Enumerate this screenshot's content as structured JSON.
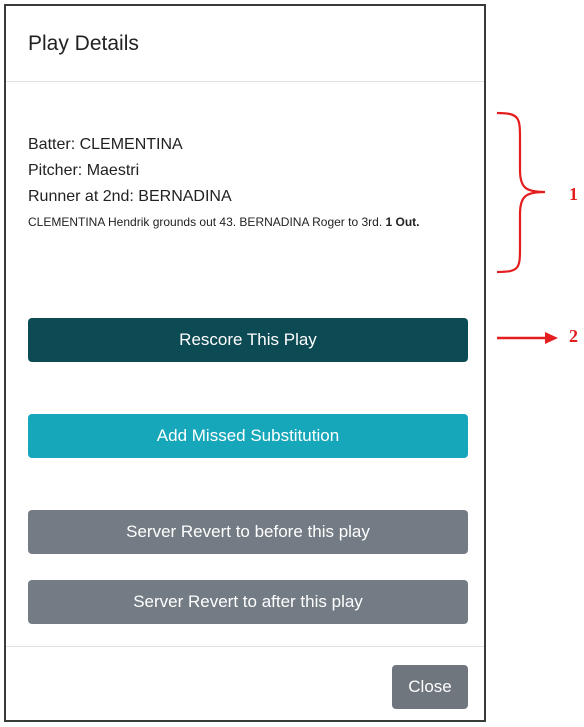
{
  "modal": {
    "title": "Play Details",
    "batter": "Batter: CLEMENTINA",
    "pitcher": "Pitcher: Maestri",
    "runner": "Runner at 2nd: BERNADINA",
    "description": "CLEMENTINA Hendrik grounds out 43. BERNADINA Roger to 3rd.",
    "outs": "1 Out."
  },
  "buttons": {
    "rescore": "Rescore This Play",
    "missed_substitution": "Add Missed Substitution",
    "revert_before": "Server Revert to before this play",
    "revert_after": "Server Revert to after this play",
    "close": "Close"
  },
  "annotations": {
    "label_1": "1",
    "label_2": "2",
    "color": "#e41e1e"
  },
  "colors": {
    "rescore_bg": "#0c4a54",
    "missed_bg": "#17a7bb",
    "revert_bg": "#737b84",
    "close_bg": "#6f767e"
  }
}
